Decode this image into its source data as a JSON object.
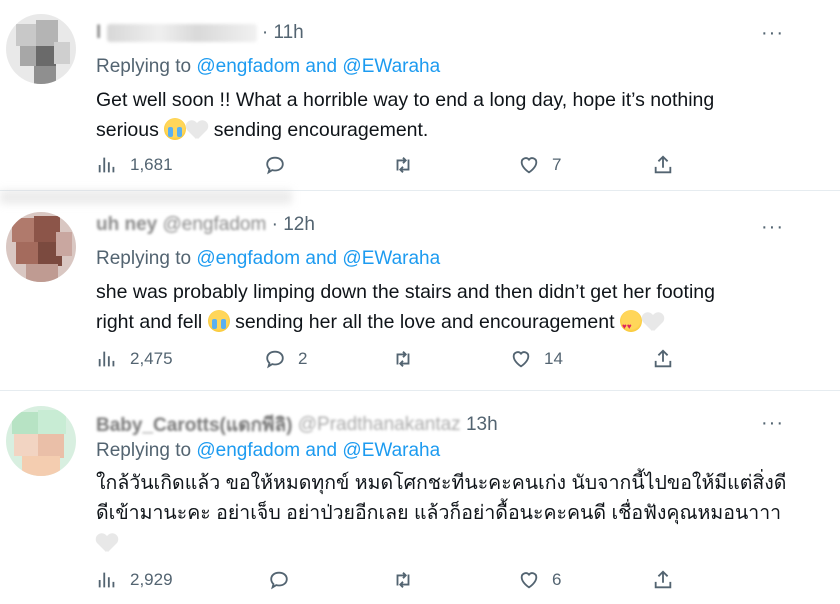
{
  "colors": {
    "link": "#1d9bf0",
    "muted": "#536471",
    "text": "#0f1419"
  },
  "tweets": [
    {
      "name_visible": "I",
      "handle_visible": "",
      "time": "· 11h",
      "replying_label": "Replying to ",
      "mention1": "@engfadom",
      "and_label": " and ",
      "mention2": "@EWaraha",
      "text_1": "Get well soon !! What a horrible way to end a long day, hope it’s nothing",
      "text_2": "serious ",
      "text_3": " sending encouragement.",
      "text_4": "",
      "emojis": [
        "crying-face-emoji",
        "white-heart-emoji"
      ],
      "views": "1,681",
      "replies": "",
      "retweets": "",
      "likes": "7",
      "more": "···"
    },
    {
      "name_visible": "uh ney",
      "handle_visible": "@engfadom",
      "time": "· 12h",
      "replying_label": "Replying to ",
      "mention1": "@engfadom",
      "and_label": " and ",
      "mention2": "@EWaraha",
      "text_1": "she was probably limping down the stairs and then didn’t get her footing",
      "text_2": "right and fell ",
      "text_3": " sending her all the love and encouragement ",
      "text_4": "",
      "emojis": [
        "crying-face-emoji",
        "smiling-face-with-hearts-emoji",
        "white-heart-emoji"
      ],
      "views": "2,475",
      "replies": "2",
      "retweets": "",
      "likes": "14",
      "more": "···"
    },
    {
      "name_visible": "Baby_Carotts(แดกพีลิ)",
      "handle_visible": "@Pradthanakantaz",
      "time": "13h",
      "replying_label": "Replying to ",
      "mention1": "@engfadom",
      "and_label": " and ",
      "mention2": "@EWaraha",
      "text_1": "ใกล้วันเกิดแล้ว ขอให้หมดทุกข์ หมดโศกชะทีนะคะคนเก่ง นับจากนี้ไปขอให้มีแต่สิ่งดี",
      "text_2": "ดีเข้ามานะคะ  อย่าเจ็บ อย่าป่วยอีกเลย แล้วก็อย่าดื้อนะคะคนดี เชื่อฟังคุณหมอนาาา",
      "text_3": "",
      "text_4": "",
      "emojis": [
        "white-heart-emoji"
      ],
      "views": "2,929",
      "replies": "",
      "retweets": "",
      "likes": "6",
      "more": "···"
    }
  ]
}
